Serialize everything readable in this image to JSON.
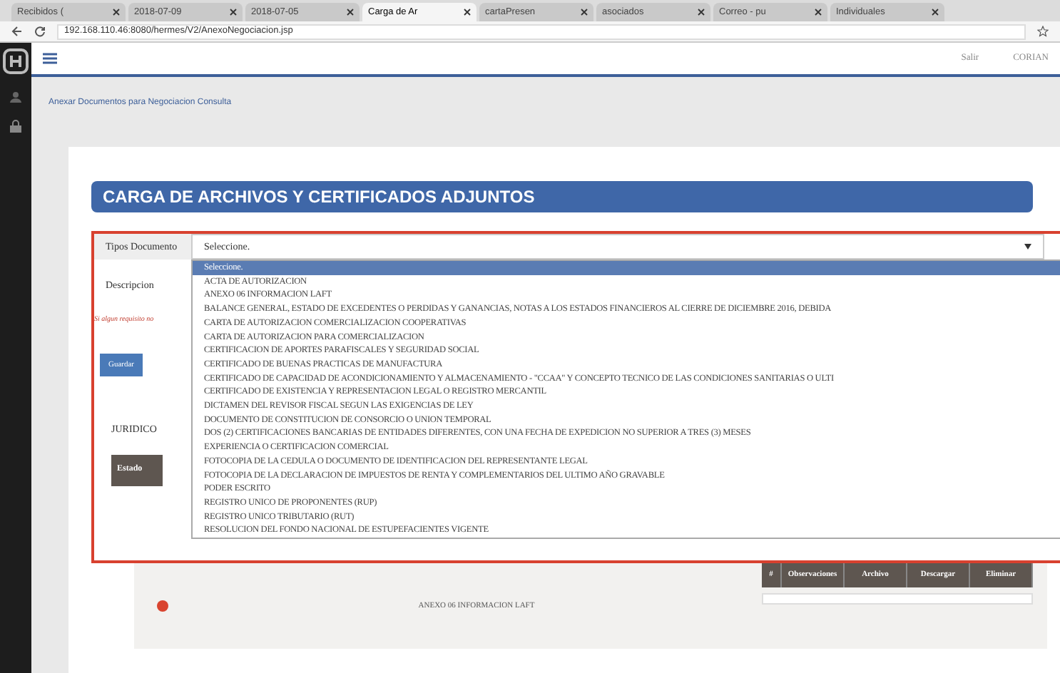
{
  "browser": {
    "tabs": [
      {
        "label": "Recibidos (",
        "selected": false
      },
      {
        "label": "2018-07-09",
        "selected": false
      },
      {
        "label": "2018-07-05",
        "selected": false
      },
      {
        "label": "Carga de Ar",
        "selected": true
      },
      {
        "label": "cartaPresen",
        "selected": false
      },
      {
        "label": "asociados",
        "selected": false
      },
      {
        "label": "Correo - pu",
        "selected": false
      },
      {
        "label": "Individuales",
        "selected": false
      }
    ],
    "address": "192.168.110.46:8080/hermes/V2/AnexoNegociacion.jsp"
  },
  "header": {
    "links": [
      "Salir",
      "CORIAN"
    ]
  },
  "breadcrumb": "Anexar Documentos para Negociacion Consulta",
  "panel_title": "CARGA DE ARCHIVOS Y CERTIFICADOS ADJUNTOS",
  "form": {
    "type_label": "Tipos Documento",
    "select_value": "Seleccione.",
    "description_label": "Descripcion",
    "notice": "Si algun requisito no",
    "save_button": "Guardar",
    "section": "JURIDICO",
    "status_header": "Estado"
  },
  "dropdown": {
    "options": [
      {
        "label": "Seleccione.",
        "selected": true
      },
      {
        "label": "ACTA DE AUTORIZACION",
        "selected": false
      },
      {
        "label": "ANEXO 06 INFORMACION LAFT",
        "selected": false
      },
      {
        "label": "BALANCE GENERAL, ESTADO DE EXCEDENTES O PERDIDAS Y GANANCIAS, NOTAS A LOS ESTADOS FINANCIEROS AL CIERRE DE DICIEMBRE 2016, DEBIDA",
        "selected": false
      },
      {
        "label": "CARTA DE AUTORIZACION COMERCIALIZACION COOPERATIVAS",
        "selected": false
      },
      {
        "label": "CARTA DE AUTORIZACION PARA COMERCIALIZACION",
        "selected": false
      },
      {
        "label": "CERTIFICACION DE APORTES PARAFISCALES Y SEGURIDAD SOCIAL",
        "selected": false
      },
      {
        "label": "CERTIFICADO DE BUENAS PRACTICAS DE MANUFACTURA",
        "selected": false
      },
      {
        "label": "CERTIFICADO DE CAPACIDAD DE ACONDICIONAMIENTO Y ALMACENAMIENTO - \"CCAA\" Y CONCEPTO TECNICO DE LAS CONDICIONES SANITARIAS O ULTI",
        "selected": false
      },
      {
        "label": "CERTIFICADO DE EXISTENCIA Y REPRESENTACION LEGAL O REGISTRO MERCANTIL",
        "selected": false
      },
      {
        "label": "DICTAMEN DEL REVISOR FISCAL SEGUN LAS EXIGENCIAS DE LEY",
        "selected": false
      },
      {
        "label": "DOCUMENTO DE CONSTITUCION DE CONSORCIO O UNION TEMPORAL",
        "selected": false
      },
      {
        "label": "DOS (2) CERTIFICACIONES BANCARIAS DE ENTIDADES DIFERENTES, CON UNA FECHA DE EXPEDICION NO SUPERIOR A TRES (3) MESES",
        "selected": false
      },
      {
        "label": "EXPERIENCIA O CERTIFICACION COMERCIAL",
        "selected": false
      },
      {
        "label": "FOTOCOPIA DE LA CEDULA O DOCUMENTO DE IDENTIFICACION DEL REPRESENTANTE LEGAL",
        "selected": false
      },
      {
        "label": "FOTOCOPIA DE LA DECLARACION DE IMPUESTOS DE RENTA Y COMPLEMENTARIOS DEL ULTIMO AÑO GRAVABLE",
        "selected": false
      },
      {
        "label": "PODER ESCRITO",
        "selected": false
      },
      {
        "label": "REGISTRO UNICO DE PROPONENTES (RUP)",
        "selected": false
      },
      {
        "label": "REGISTRO UNICO TRIBUTARIO (RUT)",
        "selected": false
      },
      {
        "label": "RESOLUCION DEL FONDO NACIONAL DE ESTUPEFACIENTES VIGENTE",
        "selected": false
      }
    ]
  },
  "table": {
    "row": {
      "name": "ANEXO 06 INFORMACION LAFT",
      "color": "#d9442f"
    },
    "columns": [
      "#",
      "Observaciones",
      "Archivo",
      "Descargar",
      "Eliminar"
    ]
  }
}
